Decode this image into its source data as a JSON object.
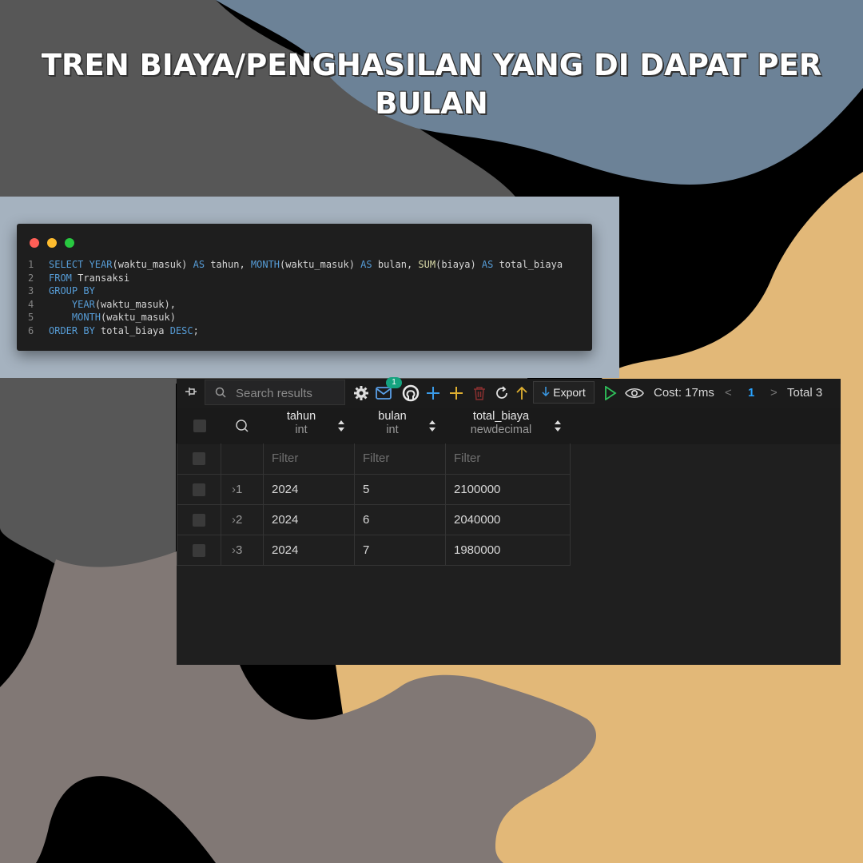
{
  "title": "TREN BIAYA/PENGHASILAN YANG DI DAPAT PER BULAN",
  "code_window": {
    "lines": [
      {
        "num": "1",
        "parts": [
          {
            "t": "SELECT ",
            "c": "kw"
          },
          {
            "t": "YEAR",
            "c": "fn-b"
          },
          {
            "t": "(waktu_masuk) ",
            "c": ""
          },
          {
            "t": "AS",
            "c": "kw"
          },
          {
            "t": " tahun, ",
            "c": ""
          },
          {
            "t": "MONTH",
            "c": "fn-b"
          },
          {
            "t": "(waktu_masuk) ",
            "c": ""
          },
          {
            "t": "AS",
            "c": "kw"
          },
          {
            "t": " bulan, ",
            "c": ""
          },
          {
            "t": "SUM",
            "c": "fn"
          },
          {
            "t": "(biaya) ",
            "c": ""
          },
          {
            "t": "AS",
            "c": "kw"
          },
          {
            "t": " total_biaya",
            "c": ""
          }
        ]
      },
      {
        "num": "2",
        "parts": [
          {
            "t": "FROM",
            "c": "kw"
          },
          {
            "t": " Transaksi",
            "c": ""
          }
        ]
      },
      {
        "num": "3",
        "parts": [
          {
            "t": "GROUP BY",
            "c": "kw"
          }
        ]
      },
      {
        "num": "4",
        "parts": [
          {
            "t": "    ",
            "c": ""
          },
          {
            "t": "YEAR",
            "c": "fn-b"
          },
          {
            "t": "(waktu_masuk),",
            "c": ""
          }
        ]
      },
      {
        "num": "5",
        "parts": [
          {
            "t": "    ",
            "c": ""
          },
          {
            "t": "MONTH",
            "c": "fn-b"
          },
          {
            "t": "(waktu_masuk)",
            "c": ""
          }
        ]
      },
      {
        "num": "6",
        "parts": [
          {
            "t": "ORDER BY",
            "c": "kw"
          },
          {
            "t": " total_biaya ",
            "c": ""
          },
          {
            "t": "DESC",
            "c": "kw"
          },
          {
            "t": ";",
            "c": ""
          }
        ]
      }
    ]
  },
  "toolbar": {
    "search_placeholder": "Search results",
    "notification_count": "1",
    "export_label": "Export",
    "cost_label": "Cost: 17ms",
    "page_prev": "<",
    "page_current": "1",
    "page_next": ">",
    "total_label": "Total 3",
    "icons": [
      "pin-icon",
      "search-icon",
      "gear-icon",
      "mail-icon",
      "github-icon",
      "plus-icon",
      "add-row-icon",
      "trash-icon",
      "refresh-icon",
      "upload-icon",
      "download-icon",
      "play-icon",
      "eye-icon"
    ]
  },
  "table": {
    "columns": [
      {
        "name": "tahun",
        "type": "int"
      },
      {
        "name": "bulan",
        "type": "int"
      },
      {
        "name": "total_biaya",
        "type": "newdecimal"
      }
    ],
    "filter_placeholder": "Filter",
    "rows": [
      {
        "index": "1",
        "cells": [
          "2024",
          "5",
          "2100000"
        ]
      },
      {
        "index": "2",
        "cells": [
          "2024",
          "6",
          "2040000"
        ]
      },
      {
        "index": "3",
        "cells": [
          "2024",
          "7",
          "1980000"
        ]
      }
    ]
  },
  "colors": {
    "blue_blob": "#6c8297",
    "gray_blob": "#575757",
    "tan_blob": "#e2b878",
    "taupe_blob": "#817875",
    "keyword": "#569cd6",
    "function": "#dcdcaa",
    "accent": "#29a3ff",
    "badge": "#14a37f"
  }
}
